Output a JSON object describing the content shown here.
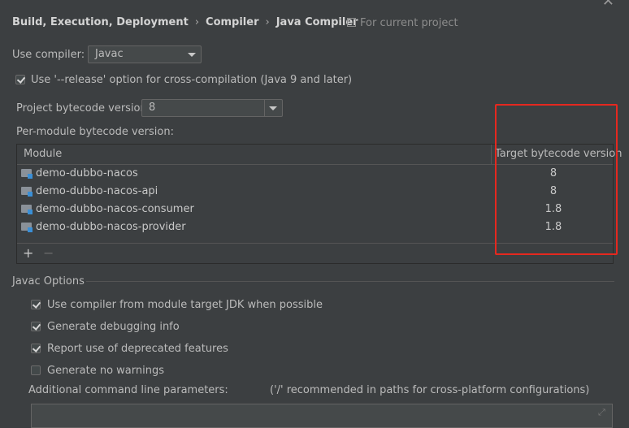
{
  "breadcrumb": {
    "parts": [
      "Build, Execution, Deployment",
      "Compiler",
      "Java Compiler"
    ],
    "sep": "›"
  },
  "scope_label": "For current project",
  "use_compiler": {
    "label": "Use compiler:",
    "value": "Javac"
  },
  "release_option": {
    "label": "Use '--release' option for cross-compilation (Java 9 and later)",
    "checked": true
  },
  "project_bytecode": {
    "label": "Project bytecode version:",
    "value": "8"
  },
  "per_module_label": "Per-module bytecode version:",
  "table": {
    "headers": {
      "module": "Module",
      "target": "Target bytecode version"
    },
    "rows": [
      {
        "module": "demo-dubbo-nacos",
        "version": "8"
      },
      {
        "module": "demo-dubbo-nacos-api",
        "version": "8"
      },
      {
        "module": "demo-dubbo-nacos-consumer",
        "version": "1.8"
      },
      {
        "module": "demo-dubbo-nacos-provider",
        "version": "1.8"
      }
    ],
    "add_label": "+",
    "remove_label": "−"
  },
  "javac_options": {
    "title": "Javac Options",
    "checkboxes": [
      {
        "label": "Use compiler from module target JDK when possible",
        "checked": true
      },
      {
        "label": "Generate debugging info",
        "checked": true
      },
      {
        "label": "Report use of deprecated features",
        "checked": true
      },
      {
        "label": "Generate no warnings",
        "checked": false
      }
    ],
    "params_label": "Additional command line parameters:",
    "params_hint": "('/' recommended in paths for cross-platform configurations)"
  },
  "colors": {
    "highlight": "#e5281f",
    "background": "#3c3f41"
  }
}
